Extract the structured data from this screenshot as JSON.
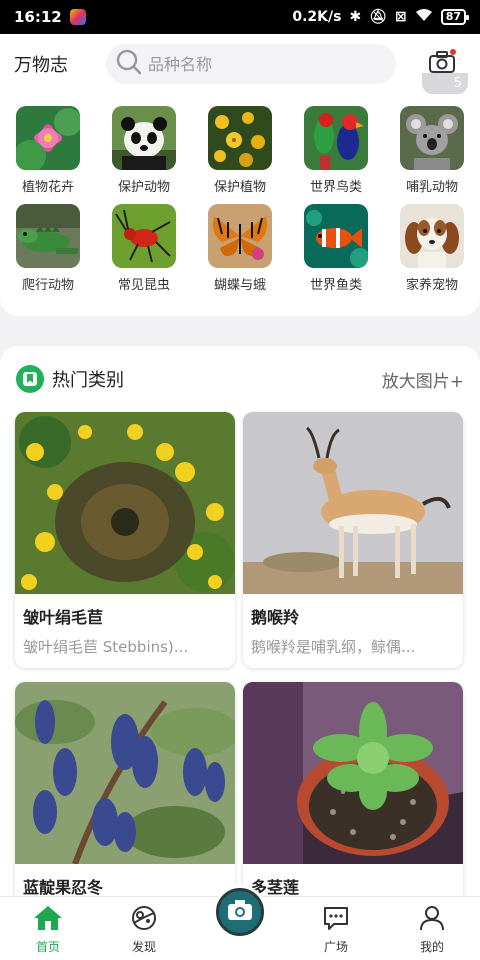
{
  "status_bar": {
    "time": "16:12",
    "speed": "0.2K/s",
    "battery": "87"
  },
  "header": {
    "title": "万物志",
    "search_placeholder": "品种名称",
    "camera_badge": "5"
  },
  "categories": [
    {
      "label": "植物花卉",
      "icon": "lotus-flower"
    },
    {
      "label": "保护动物",
      "icon": "panda"
    },
    {
      "label": "保护植物",
      "icon": "yellow-flowers"
    },
    {
      "label": "世界鸟类",
      "icon": "parrot"
    },
    {
      "label": "哺乳动物",
      "icon": "koala"
    },
    {
      "label": "爬行动物",
      "icon": "iguana"
    },
    {
      "label": "常见昆虫",
      "icon": "red-insect"
    },
    {
      "label": "蝴蝶与蛾",
      "icon": "butterfly"
    },
    {
      "label": "世界鱼类",
      "icon": "clownfish"
    },
    {
      "label": "家养宠物",
      "icon": "puppy"
    }
  ],
  "hot": {
    "title": "热门类别",
    "more": "放大图片+",
    "items": [
      {
        "name": "皱叶绢毛苣",
        "desc": "皱叶绢毛苣 Stebbins)..."
      },
      {
        "name": "鹅喉羚",
        "desc": "鹅喉羚是哺乳纲，鲸偶..."
      },
      {
        "name": "蓝靛果忍冬",
        "desc": ""
      },
      {
        "name": "多茎莲",
        "desc": ""
      }
    ]
  },
  "nav": {
    "home": "首页",
    "discover": "发现",
    "plaza": "广场",
    "mine": "我的"
  },
  "colors": {
    "accent": "#1fb25a",
    "camera": "#1d6f74"
  }
}
